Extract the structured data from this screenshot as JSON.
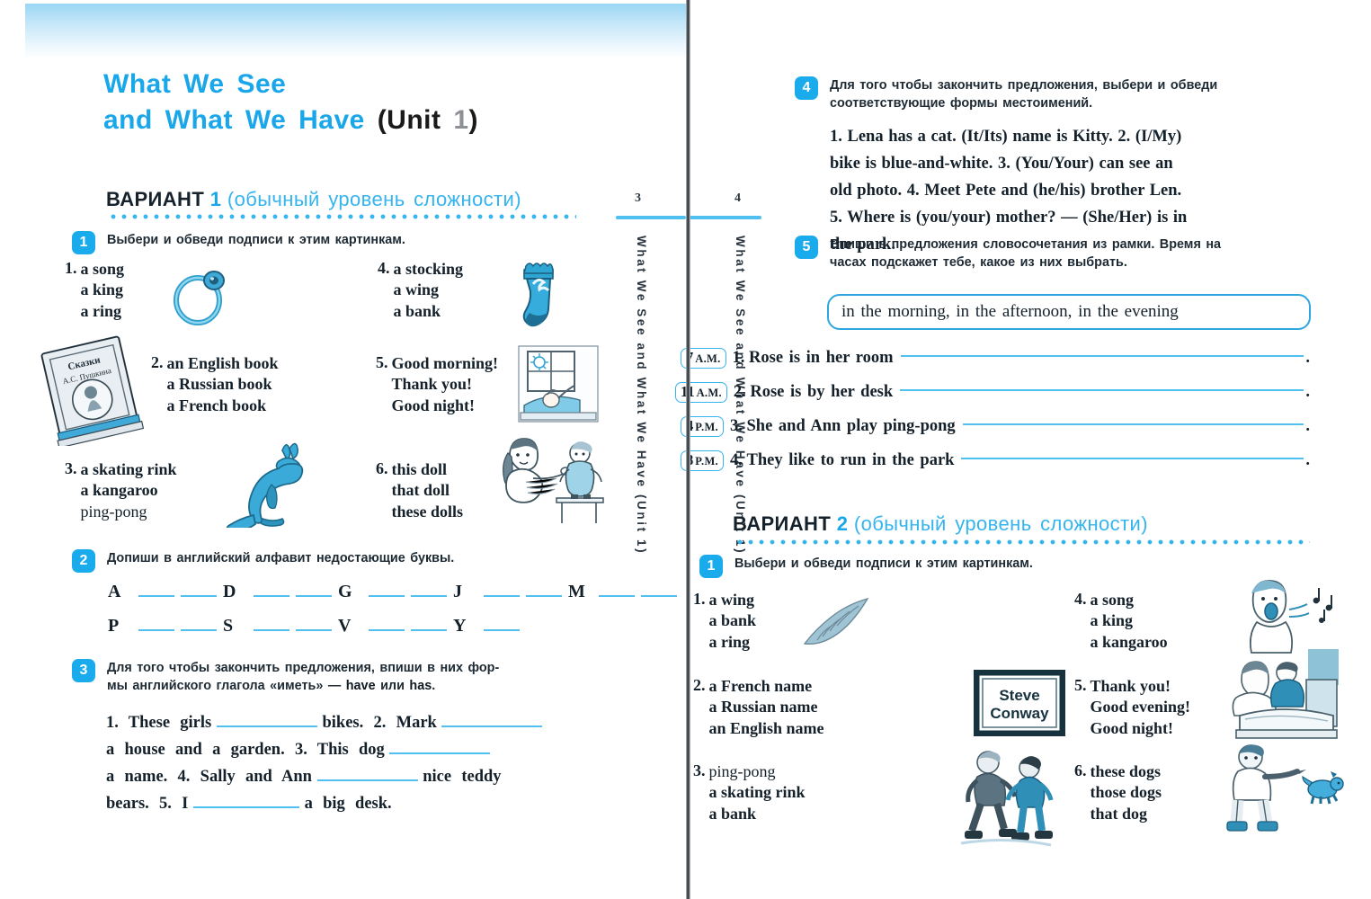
{
  "book": {
    "unit_title_line1": "What We See",
    "unit_title_line2": "and What We Have",
    "unit_paren_open": "(Unit",
    "unit_number": "1",
    "unit_paren_close": ")"
  },
  "left_page": {
    "page_number": "3",
    "running_head": "What We See and What We Have (Unit 1)",
    "variant": {
      "word": "ВАРИАНТ",
      "number": "1",
      "subtitle": "(обычный уровень сложности)"
    },
    "exercises": [
      {
        "number": "1",
        "prompt": "Выбери и обведи подписи к этим картинкам.",
        "items": [
          {
            "num": "1.",
            "options": [
              "a song",
              "a king",
              "a ring"
            ],
            "picture": "ring"
          },
          {
            "num": "2.",
            "options": [
              "an English book",
              "a Russian book",
              "a French book"
            ],
            "picture": "book"
          },
          {
            "num": "3.",
            "options": [
              "a skating rink",
              "a kangaroo",
              "ping-pong"
            ],
            "picture": "kangaroo"
          },
          {
            "num": "4.",
            "options": [
              "a stocking",
              "a wing",
              "a bank"
            ],
            "picture": "stocking"
          },
          {
            "num": "5.",
            "options": [
              "Good morning!",
              "Thank you!",
              "Good night!"
            ],
            "picture": "morning-window"
          },
          {
            "num": "6.",
            "options": [
              "this doll",
              "that doll",
              "these dolls"
            ],
            "picture": "girl-doll"
          }
        ]
      },
      {
        "number": "2",
        "prompt": "Допиши в английский алфавит недостающие буквы.",
        "alphabet_rows": [
          [
            "A",
            "D",
            "G",
            "J",
            "M"
          ],
          [
            "P",
            "S",
            "V",
            "Y"
          ]
        ],
        "alphabet_gaps": [
          [
            2,
            2,
            2,
            2,
            2
          ],
          [
            2,
            2,
            2,
            1
          ]
        ]
      },
      {
        "number": "3",
        "prompt_line1": "Для того чтобы закончить предложения, впиши в них фор-",
        "prompt_line2_pre": "мы английского глагола «иметь» — ",
        "prompt_have": "have",
        "prompt_or": " или ",
        "prompt_has": "has",
        "prompt_end": ".",
        "body_lines": [
          "1. These girls ______ bikes. 2. Mark ______",
          "a house and a garden. 3. This dog ______",
          "a name. 4. Sally and Ann ______ nice teddy",
          "bears. 5. I ______ a big desk."
        ]
      }
    ]
  },
  "right_page": {
    "page_number": "4",
    "running_head": "What We See and What We Have (Unit 1)",
    "exercises": [
      {
        "number": "4",
        "prompt_line1": "Для того чтобы закончить предложения, выбери и обведи",
        "prompt_line2": "соответствующие формы местоимений.",
        "body_lines": [
          "1. Lena has a cat. (It/Its) name is Kitty. 2. (I/My)",
          "bike is blue-and-white. 3. (You/Your) can see an",
          "old photo. 4. Meet Pete and (he/his) brother Len.",
          "5. Where is (you/your) mother? — (She/Her) is in",
          "the park."
        ]
      },
      {
        "number": "5",
        "prompt_line1": "Впиши в предложения словосочетания из рамки. Время на",
        "prompt_line2": "часах подскажет тебе, какое из них выбрать.",
        "frame_phrases": "in the morning,   in the afternoon,   in the evening",
        "sentences": [
          {
            "hour": "7",
            "meridiem": "A.M.",
            "num": "1.",
            "text": "Rose is in her room"
          },
          {
            "hour": "11",
            "meridiem": "A.M.",
            "num": "2.",
            "text": "Rose is by her desk"
          },
          {
            "hour": "4",
            "meridiem": "P.M.",
            "num": "3.",
            "text": "She and Ann play ping-pong"
          },
          {
            "hour": "8",
            "meridiem": "P.M.",
            "num": "4.",
            "text": "They like to run in the park"
          }
        ]
      }
    ],
    "variant": {
      "word": "ВАРИАНТ",
      "number": "2",
      "subtitle": "(обычный уровень сложности)"
    },
    "variant2_exercise": {
      "number": "1",
      "prompt": "Выбери и обведи подписи к этим картинкам.",
      "items": [
        {
          "num": "1.",
          "options": [
            "a wing",
            "a bank",
            "a ring"
          ],
          "picture": "wing"
        },
        {
          "num": "2.",
          "options": [
            "a French name",
            "a Russian name",
            "an English name"
          ],
          "picture": "nameplate"
        },
        {
          "num": "3.",
          "options": [
            "ping-pong",
            "a skating rink",
            "a bank"
          ],
          "picture": "skaters"
        },
        {
          "num": "4.",
          "options": [
            "a song",
            "a king",
            "a kangaroo"
          ],
          "picture": "singer"
        },
        {
          "num": "5.",
          "options": [
            "Thank you!",
            "Good evening!",
            "Good night!"
          ],
          "picture": "bedtime"
        },
        {
          "num": "6.",
          "options": [
            "these dogs",
            "those dogs",
            "that dog"
          ],
          "picture": "boy-dogs"
        }
      ]
    },
    "nameplate_text_line1": "Steve",
    "nameplate_text_line2": "Conway"
  },
  "colors": {
    "accent_blue": "#1aabec",
    "rule_blue": "#4fc0f0",
    "title_blue": "#1aa7ea",
    "text_dark": "#14202a"
  }
}
